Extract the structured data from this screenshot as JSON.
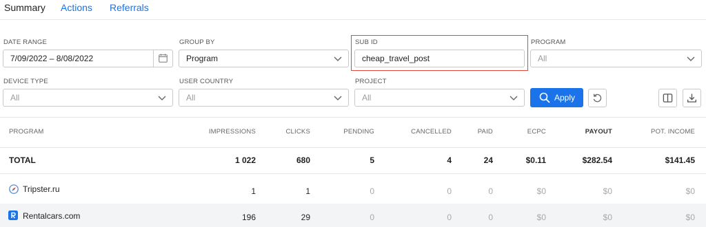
{
  "tabs": [
    {
      "label": "Summary",
      "active": true
    },
    {
      "label": "Actions",
      "active": false
    },
    {
      "label": "Referrals",
      "active": false
    }
  ],
  "filters": {
    "date_range": {
      "label": "DATE RANGE",
      "value": "7/09/2022 – 8/08/2022",
      "icon": "calendar-icon"
    },
    "group_by": {
      "label": "GROUP BY",
      "value": "Program"
    },
    "sub_id": {
      "label": "SUB ID",
      "value": "cheap_travel_post"
    },
    "program": {
      "label": "PROGRAM",
      "placeholder": "All"
    },
    "device_type": {
      "label": "DEVICE TYPE",
      "placeholder": "All"
    },
    "user_country": {
      "label": "USER COUNTRY",
      "placeholder": "All"
    },
    "project": {
      "label": "PROJECT",
      "placeholder": "All"
    },
    "apply_label": "Apply"
  },
  "table": {
    "headers": {
      "program": "PROGRAM",
      "impressions": "IMPRESSIONS",
      "clicks": "CLICKS",
      "pending": "PENDING",
      "cancelled": "CANCELLED",
      "paid": "PAID",
      "ecpc": "ECPC",
      "payout": "PAYOUT",
      "pot_income": "POT. INCOME"
    },
    "total": {
      "name": "TOTAL",
      "impressions": "1 022",
      "clicks": "680",
      "pending": "5",
      "cancelled": "4",
      "paid": "24",
      "ecpc": "$0.11",
      "payout": "$282.54",
      "pot_income": "$141.45"
    },
    "rows": [
      {
        "name": "Tripster.ru",
        "icon": "compass-icon",
        "impressions": "1",
        "clicks": "1",
        "pending": "0",
        "cancelled": "0",
        "paid": "0",
        "ecpc": "$0",
        "payout": "$0",
        "pot_income": "$0"
      },
      {
        "name": "Rentalcars.com",
        "icon": "rentalcars-logo-icon",
        "impressions": "196",
        "clicks": "29",
        "pending": "0",
        "cancelled": "0",
        "paid": "0",
        "ecpc": "$0",
        "payout": "$0",
        "pot_income": "$0"
      }
    ]
  },
  "colors": {
    "accent": "#1a73e8",
    "highlight": "#e0463c",
    "muted": "#a9a9a9"
  }
}
